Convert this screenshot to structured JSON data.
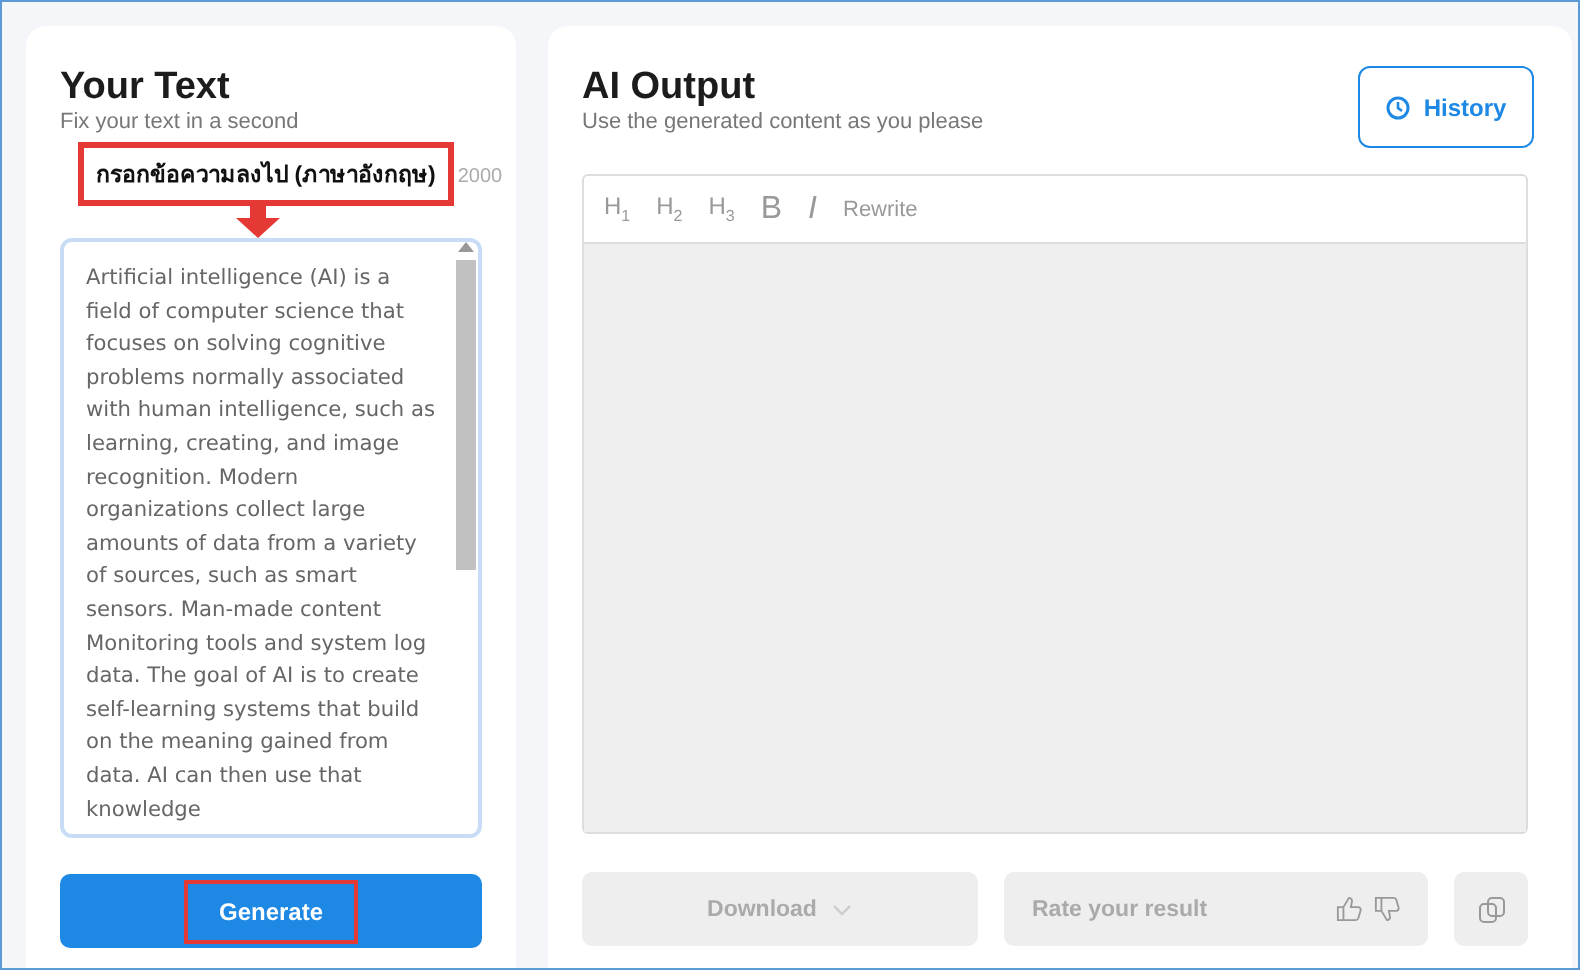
{
  "input_panel": {
    "title": "Your Text",
    "subtitle": "Fix your text in a second",
    "counter": "2000",
    "annotation": "กรอกข้อความลงไป (ภาษาอังกฤษ)",
    "text": "Artificial intelligence (AI) is a field of computer science that focuses on solving cognitive problems normally associated with human intelligence, such as learning, creating, and image recognition. Modern organizations collect large amounts of data from a variety of sources, such as smart sensors. Man-made content Monitoring tools and system log data. The goal of AI is to create self-learning systems that build on the meaning gained from data. AI can then use that knowledge",
    "generate_button": "Generate",
    "generate_highlighted": true
  },
  "output_panel": {
    "title": "AI Output",
    "subtitle": "Use the generated content as you please",
    "history_button": "History",
    "toolbar": [
      {
        "label": "H",
        "sub": "1",
        "kind": "heading"
      },
      {
        "label": "H",
        "sub": "2",
        "kind": "heading"
      },
      {
        "label": "H",
        "sub": "3",
        "kind": "heading"
      },
      {
        "label": "B",
        "kind": "bold"
      },
      {
        "label": "I",
        "kind": "italic"
      },
      {
        "label": "Rewrite",
        "kind": "text"
      }
    ],
    "download_button": "Download",
    "rate_label": "Rate your result"
  }
}
